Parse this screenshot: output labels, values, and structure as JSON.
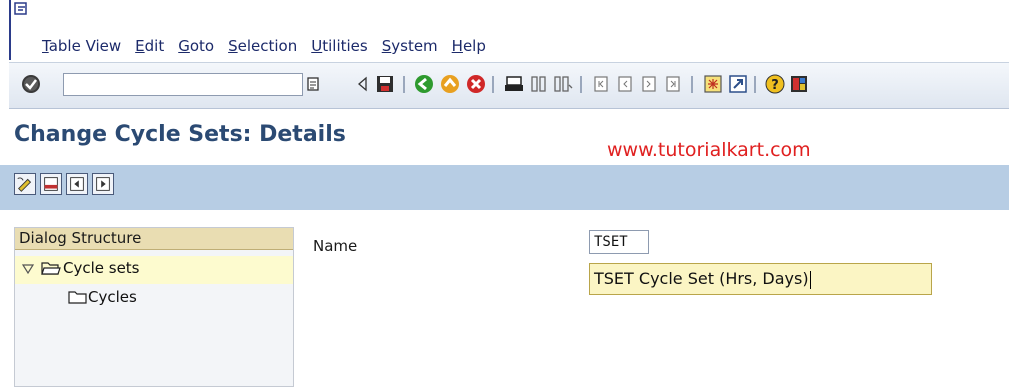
{
  "menubar": {
    "items": [
      "Table View",
      "Edit",
      "Goto",
      "Selection",
      "Utilities",
      "System",
      "Help"
    ]
  },
  "toolbar": {
    "command_field_value": "",
    "icons": [
      "enter-icon",
      "back-arrow-icon",
      "save-icon",
      "back-icon",
      "exit-icon",
      "cancel-icon",
      "print-icon",
      "find-icon",
      "find-next-icon",
      "first-page-icon",
      "prev-page-icon",
      "next-page-icon",
      "last-page-icon",
      "new-session-icon",
      "shortcut-icon",
      "help-icon",
      "customize-layout-icon"
    ]
  },
  "page": {
    "title": "Change Cycle Sets: Details",
    "watermark": "www.tutorialkart.com"
  },
  "dialog_structure": {
    "header": "Dialog Structure",
    "items": [
      {
        "label": "Cycle sets",
        "expanded": true,
        "selected": true
      },
      {
        "label": "Cycles",
        "expanded": false,
        "selected": false
      }
    ]
  },
  "form": {
    "name_label": "Name",
    "name_value": "TSET",
    "description_value": "TSET Cycle Set (Hrs, Days)"
  },
  "colors": {
    "title": "#2b4a73",
    "watermark": "#e02020",
    "app_toolbar": "#b7cde4",
    "selected_row": "#fdfbcf",
    "dialog_header": "#e9ddb2"
  }
}
